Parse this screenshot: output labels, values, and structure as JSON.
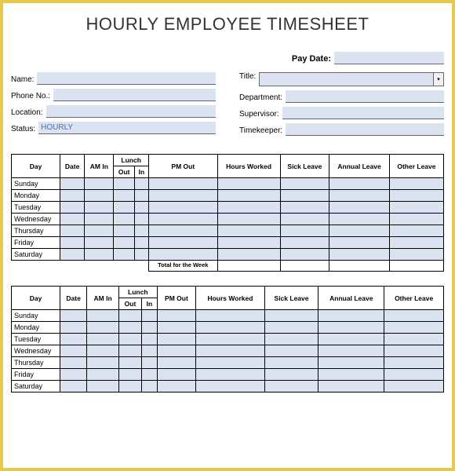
{
  "title": "HOURLY EMPLOYEE TIMESHEET",
  "header": {
    "paydate_label": "Pay Date:",
    "paydate_value": "",
    "left": {
      "name_label": "Name:",
      "name_value": "",
      "phone_label": "Phone No.:",
      "phone_value": "",
      "location_label": "Location:",
      "location_value": "",
      "status_label": "Status:",
      "status_value": "HOURLY"
    },
    "right": {
      "title_label": "Title:",
      "title_value": "",
      "department_label": "Department:",
      "department_value": "",
      "supervisor_label": "Supervisor:",
      "supervisor_value": "",
      "timekeeper_label": "Timekeeper:",
      "timekeeper_value": ""
    }
  },
  "columns": {
    "day": "Day",
    "date": "Date",
    "am_in": "AM In",
    "lunch": "Lunch",
    "lunch_out": "Out",
    "lunch_in": "In",
    "pm_out": "PM Out",
    "hours_worked": "Hours Worked",
    "sick_leave": "Sick Leave",
    "annual_leave": "Annual Leave",
    "other_leave": "Other Leave"
  },
  "days": [
    "Sunday",
    "Monday",
    "Tuesday",
    "Wednesday",
    "Thursday",
    "Friday",
    "Saturday"
  ],
  "total_label": "Total for the Week",
  "week1": [
    {
      "date": "",
      "am_in": "",
      "lunch_out": "",
      "lunch_in": "",
      "pm_out": "",
      "hours": "",
      "sick": "",
      "annual": "",
      "other": ""
    },
    {
      "date": "",
      "am_in": "",
      "lunch_out": "",
      "lunch_in": "",
      "pm_out": "",
      "hours": "",
      "sick": "",
      "annual": "",
      "other": ""
    },
    {
      "date": "",
      "am_in": "",
      "lunch_out": "",
      "lunch_in": "",
      "pm_out": "",
      "hours": "",
      "sick": "",
      "annual": "",
      "other": ""
    },
    {
      "date": "",
      "am_in": "",
      "lunch_out": "",
      "lunch_in": "",
      "pm_out": "",
      "hours": "",
      "sick": "",
      "annual": "",
      "other": ""
    },
    {
      "date": "",
      "am_in": "",
      "lunch_out": "",
      "lunch_in": "",
      "pm_out": "",
      "hours": "",
      "sick": "",
      "annual": "",
      "other": ""
    },
    {
      "date": "",
      "am_in": "",
      "lunch_out": "",
      "lunch_in": "",
      "pm_out": "",
      "hours": "",
      "sick": "",
      "annual": "",
      "other": ""
    },
    {
      "date": "",
      "am_in": "",
      "lunch_out": "",
      "lunch_in": "",
      "pm_out": "",
      "hours": "",
      "sick": "",
      "annual": "",
      "other": ""
    }
  ],
  "week1_total": {
    "hours": "",
    "sick": "",
    "annual": "",
    "other": ""
  },
  "week2": [
    {
      "date": "",
      "am_in": "",
      "lunch_out": "",
      "lunch_in": "",
      "pm_out": "",
      "hours": "",
      "sick": "",
      "annual": "",
      "other": ""
    },
    {
      "date": "",
      "am_in": "",
      "lunch_out": "",
      "lunch_in": "",
      "pm_out": "",
      "hours": "",
      "sick": "",
      "annual": "",
      "other": ""
    },
    {
      "date": "",
      "am_in": "",
      "lunch_out": "",
      "lunch_in": "",
      "pm_out": "",
      "hours": "",
      "sick": "",
      "annual": "",
      "other": ""
    },
    {
      "date": "",
      "am_in": "",
      "lunch_out": "",
      "lunch_in": "",
      "pm_out": "",
      "hours": "",
      "sick": "",
      "annual": "",
      "other": ""
    },
    {
      "date": "",
      "am_in": "",
      "lunch_out": "",
      "lunch_in": "",
      "pm_out": "",
      "hours": "",
      "sick": "",
      "annual": "",
      "other": ""
    },
    {
      "date": "",
      "am_in": "",
      "lunch_out": "",
      "lunch_in": "",
      "pm_out": "",
      "hours": "",
      "sick": "",
      "annual": "",
      "other": ""
    },
    {
      "date": "",
      "am_in": "",
      "lunch_out": "",
      "lunch_in": "",
      "pm_out": "",
      "hours": "",
      "sick": "",
      "annual": "",
      "other": ""
    }
  ]
}
